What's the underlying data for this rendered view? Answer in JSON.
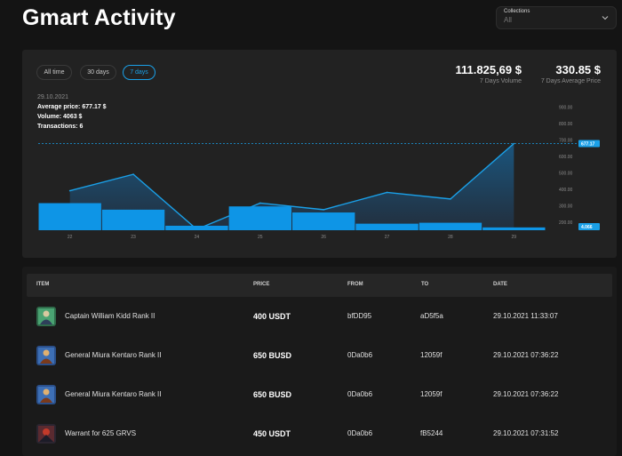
{
  "header": {
    "title": "Gmart Activity"
  },
  "collections": {
    "label": "Collections",
    "value": "All"
  },
  "ranges": [
    {
      "label": "All time",
      "active": false
    },
    {
      "label": "30 days",
      "active": false
    },
    {
      "label": "7 days",
      "active": true
    }
  ],
  "stats": {
    "volume": {
      "value": "111.825,69 $",
      "label": "7 Days Volume"
    },
    "avg_price": {
      "value": "330.85 $",
      "label": "7 Days Average Price"
    }
  },
  "tooltip": {
    "date": "29.10.2021",
    "avg": "Average price: 677.17 $",
    "volume": "Volume: 4063 $",
    "transactions": "Transactions: 6"
  },
  "chart_data": {
    "type": "bar",
    "categories": [
      "22",
      "23",
      "24",
      "25",
      "26",
      "27",
      "28",
      "29"
    ],
    "series": [
      {
        "type": "line",
        "values": [
          390,
          490,
          20,
          315,
          275,
          380,
          340,
          677
        ]
      },
      {
        "type": "bar",
        "values": [
          2900,
          2200,
          480,
          2550,
          1900,
          700,
          800,
          300
        ]
      }
    ],
    "y_ticks": [
      "900.00",
      "800.00",
      "700.00",
      "600.00",
      "500.00",
      "400.00",
      "300.00",
      "200.00"
    ],
    "y_tick_values": [
      900,
      800,
      700,
      600,
      500,
      400,
      300,
      200
    ],
    "ylim": [
      150,
      950
    ],
    "markers": [
      {
        "label": "677.17",
        "value": 677.17
      },
      {
        "label": "4.066",
        "value": 150
      }
    ],
    "grid": false,
    "colors": {
      "line": "#1aa0e8",
      "bar": "#0e95e6",
      "fill_top": "#1a5a86",
      "fill_bottom": "#223040"
    }
  },
  "table": {
    "headers": {
      "item": "ITEM",
      "price": "PRICE",
      "from": "FROM",
      "to": "TO",
      "date": "DATE"
    },
    "rows": [
      {
        "item": "Captain William Kidd Rank II",
        "price": "400 USDT",
        "from": "bfDD95",
        "to": "aD5f5a",
        "date": "29.10.2021 11:33:07",
        "thumb": "green"
      },
      {
        "item": "General Miura Kentaro Rank II",
        "price": "650 BUSD",
        "from": "0Da0b6",
        "to": "12059f",
        "date": "29.10.2021 07:36:22",
        "thumb": "blue"
      },
      {
        "item": "General Miura Kentaro Rank II",
        "price": "650 BUSD",
        "from": "0Da0b6",
        "to": "12059f",
        "date": "29.10.2021 07:36:22",
        "thumb": "blue"
      },
      {
        "item": "Warrant for 625 GRVS",
        "price": "450 USDT",
        "from": "0Da0b6",
        "to": "fB5244",
        "date": "29.10.2021 07:31:52",
        "thumb": "red"
      }
    ]
  }
}
